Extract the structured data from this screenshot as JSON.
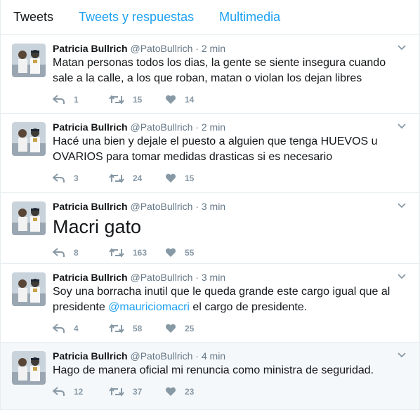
{
  "tabs": [
    {
      "label": "Tweets"
    },
    {
      "label": "Tweets y respuestas"
    },
    {
      "label": "Multimedia"
    }
  ],
  "author": {
    "name": "Patricia Bullrich",
    "handle": "@PatoBullrich",
    "separator": "·"
  },
  "tweets": [
    {
      "time": "2 min",
      "text": "Matan personas todos los dias, la gente se siente insegura cuando sale a la calle, a los que roban, matan o violan los dejan libres",
      "replies": "1",
      "retweets": "15",
      "likes": "14"
    },
    {
      "time": "2 min",
      "text": "Hacé una bien y dejale el puesto a alguien que tenga HUEVOS u OVARIOS para tomar medidas drasticas si es necesario",
      "replies": "3",
      "retweets": "24",
      "likes": "15"
    },
    {
      "time": "3 min",
      "text": "Macri gato",
      "replies": "8",
      "retweets": "163",
      "likes": "55"
    },
    {
      "time": "3 min",
      "text_before": "Soy una borracha inutil que le queda grande este cargo igual que al presidente ",
      "mention": "@mauriciomacri",
      "text_after": " el cargo de presidente.",
      "replies": "4",
      "retweets": "58",
      "likes": "25"
    },
    {
      "time": "4 min",
      "text": "Hago de manera oficial mi renuncia como ministra de seguridad.",
      "replies": "12",
      "retweets": "37",
      "likes": "23"
    }
  ],
  "colors": {
    "link": "#1da1f2",
    "muted": "#8899a6",
    "text": "#14171a",
    "highlight_bg": "#f5f8fa"
  },
  "icons": [
    "reply-icon",
    "retweet-icon",
    "heart-icon",
    "chevron-down-icon"
  ]
}
